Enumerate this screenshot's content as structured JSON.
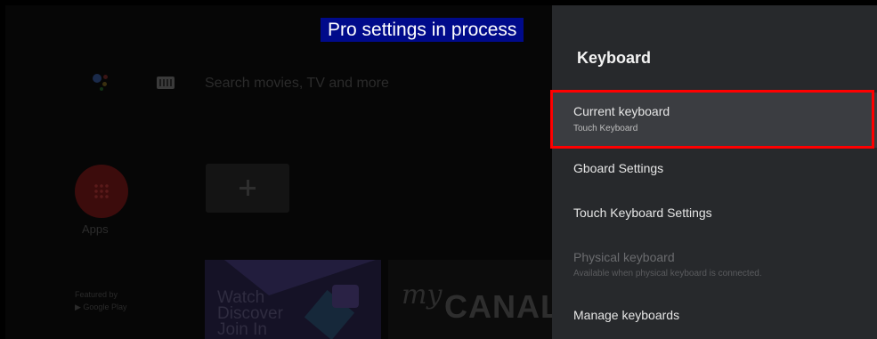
{
  "banner": {
    "text": "Pro settings in process",
    "color": "#000a8a"
  },
  "home": {
    "search_placeholder": "Search movies, TV and more",
    "apps_label": "Apps",
    "featured_line1": "Featured by",
    "featured_line2": "▶ Google Play",
    "card_watch_lines": [
      "Watch",
      "Discover",
      "Join In"
    ],
    "card_canal_my": "my",
    "card_canal_text": "CANAL",
    "icons": [
      "google-assistant-icon",
      "keyboard-icon",
      "apps-grid-icon",
      "plus-icon",
      "twitch-icon"
    ]
  },
  "panel": {
    "title": "Keyboard",
    "items": [
      {
        "title": "Current keyboard",
        "subtitle": "Touch Keyboard",
        "selected": true,
        "enabled": true
      },
      {
        "title": "Gboard Settings",
        "enabled": true
      },
      {
        "title": "Touch Keyboard Settings",
        "enabled": true
      },
      {
        "title": "Physical keyboard",
        "subtitle": "Available when physical keyboard is connected.",
        "enabled": false
      },
      {
        "title": "Manage keyboards",
        "enabled": true
      }
    ]
  },
  "colors": {
    "panel_bg": "#27292c",
    "selected_bg": "#3b3d41",
    "highlight_border": "#ff0000"
  }
}
